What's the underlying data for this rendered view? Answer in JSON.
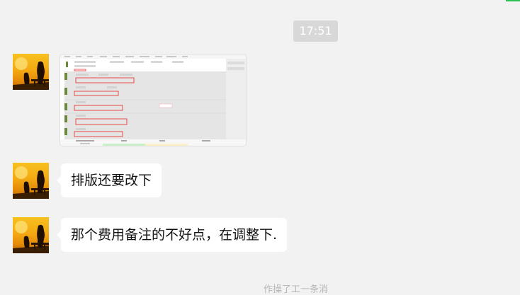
{
  "chat": {
    "timestamp": "17:51",
    "messages": [
      {
        "type": "image",
        "content": "screenshot"
      },
      {
        "type": "text",
        "text": "排版还要改下"
      },
      {
        "type": "text",
        "text": "那个费用备注的不好点，在调整下."
      }
    ],
    "bottom_hint": "作操了工一条消"
  },
  "colors": {
    "background": "#f2f2f2",
    "bubble": "#ffffff",
    "timestamp_bg": "#d8d8d8",
    "accent": "#2ec15a",
    "thumb_highlight": "#e53935"
  }
}
